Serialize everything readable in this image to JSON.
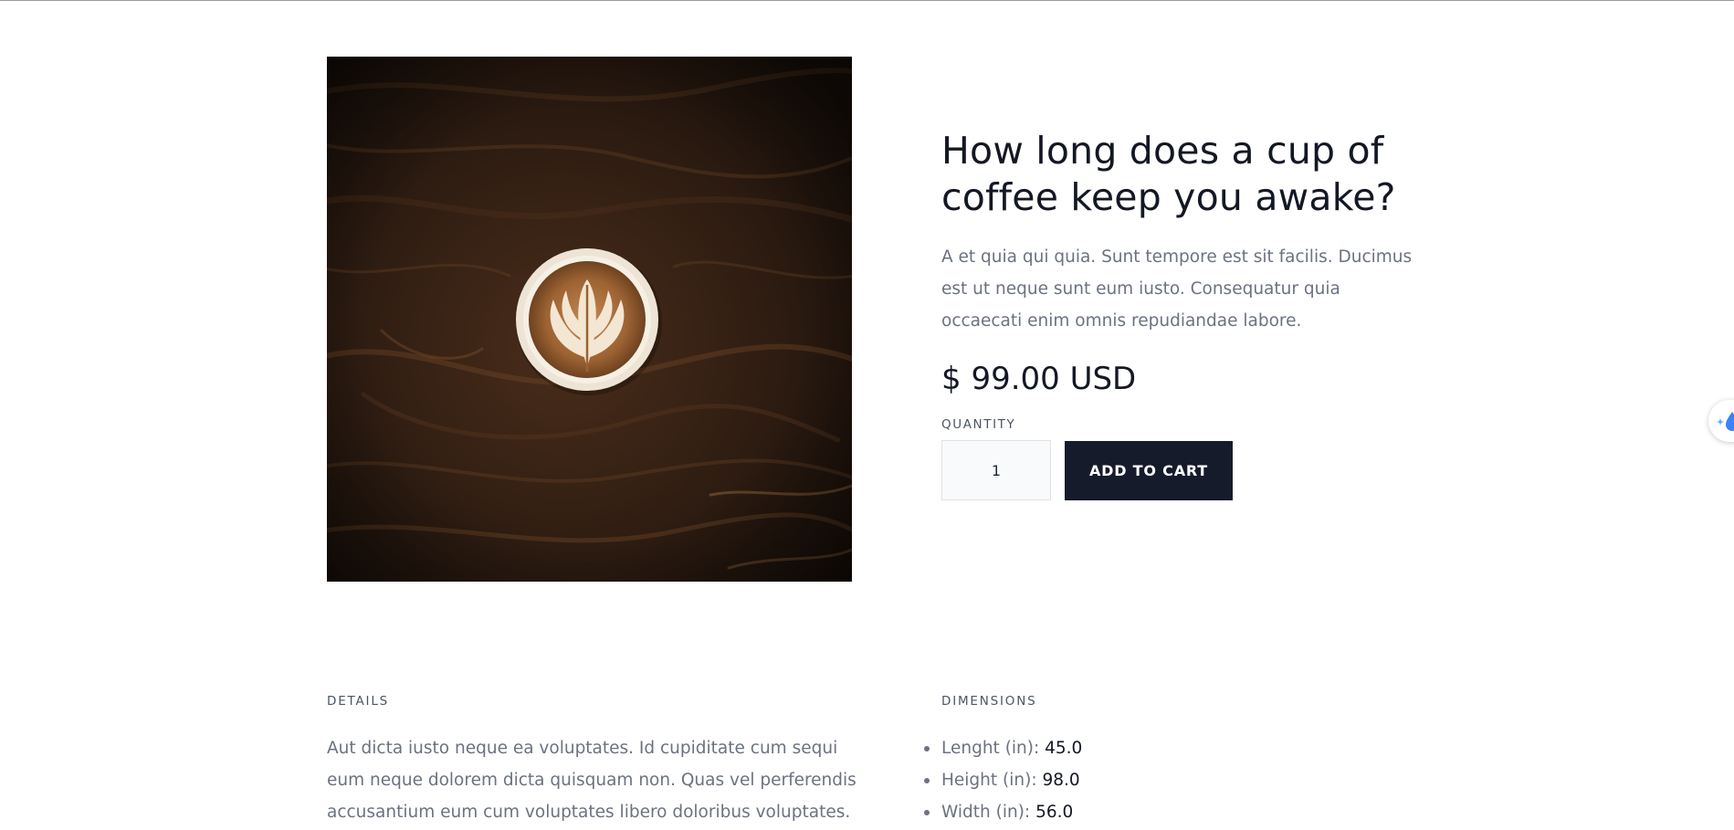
{
  "product": {
    "title": "How long does a cup of coffee keep you awake?",
    "description": "A et quia qui quia. Sunt tempore est sit facilis. Ducimus est ut neque sunt eum iusto. Consequatur quia occaecati enim omnis repudiandae labore.",
    "price": "$ 99.00 USD",
    "quantity_label": "QUANTITY",
    "quantity_value": "1",
    "add_to_cart_label": "ADD TO CART",
    "image_icon": "coffee-latte-photo"
  },
  "details": {
    "label": "DETAILS",
    "text": "Aut dicta iusto neque ea voluptates. Id cupiditate cum sequi eum neque dolorem dicta quisquam non. Quas vel perferendis accusantium eum cum voluptates libero doloribus voluptates."
  },
  "dimensions": {
    "label": "DIMENSIONS",
    "items": [
      {
        "key": "Lenght (in):",
        "value": "45.0"
      },
      {
        "key": "Height (in):",
        "value": "98.0"
      },
      {
        "key": "Width (in):",
        "value": "56.0"
      }
    ]
  },
  "side_widget": {
    "icon": "water-drop-sparkle-icon"
  },
  "colors": {
    "button_bg": "#161b2c",
    "heading": "#141824",
    "body_text": "#6b7280",
    "wood_dark": "#2a1a10"
  }
}
